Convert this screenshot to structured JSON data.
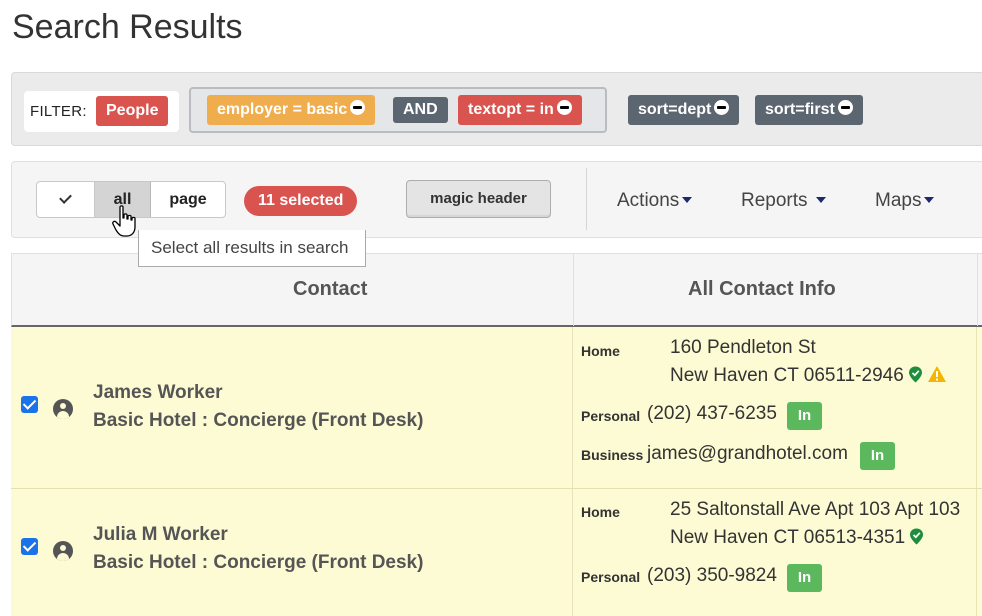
{
  "page": {
    "title": "Search Results"
  },
  "filters": {
    "label": "FILTER:",
    "type_tag": "People",
    "employer_tag": "employer = basic",
    "operator": "AND",
    "textopt_tag": "textopt = in",
    "sort_dept": "sort=dept",
    "sort_first": "sort=first"
  },
  "toolbar": {
    "select_all": "all",
    "select_page": "page",
    "selected_count": "11 selected",
    "magic_header": "magic header",
    "actions": "Actions",
    "reports": "Reports",
    "maps": "Maps",
    "tooltip": "Select all results in search"
  },
  "table": {
    "headers": [
      "Contact",
      "All Contact Info"
    ],
    "rows": [
      {
        "name": "James Worker",
        "title": "Basic Hotel : Concierge (Front Desk)",
        "checked": true,
        "home_label": "Home",
        "address_line1": "160 Pendleton St",
        "address_line2": "New Haven CT 06511-2946",
        "personal_label": "Personal",
        "phone": "(202) 437-6235",
        "business_label": "Business",
        "email": "james@grandhotel.com",
        "in_label": "In"
      },
      {
        "name": "Julia M Worker",
        "title": "Basic Hotel : Concierge (Front Desk)",
        "checked": true,
        "home_label": "Home",
        "address_line1": "25 Saltonstall Ave Apt 103 Apt 103",
        "address_line2": "New Haven CT 06513-4351",
        "personal_label": "Personal",
        "phone": "(203) 350-9824",
        "in_label": "In"
      }
    ]
  },
  "colors": {
    "red": "#d9534f",
    "orange": "#f0ad4e",
    "gray": "#5c6670",
    "green": "#5cb85c",
    "row_highlight": "#fdfbd3"
  }
}
